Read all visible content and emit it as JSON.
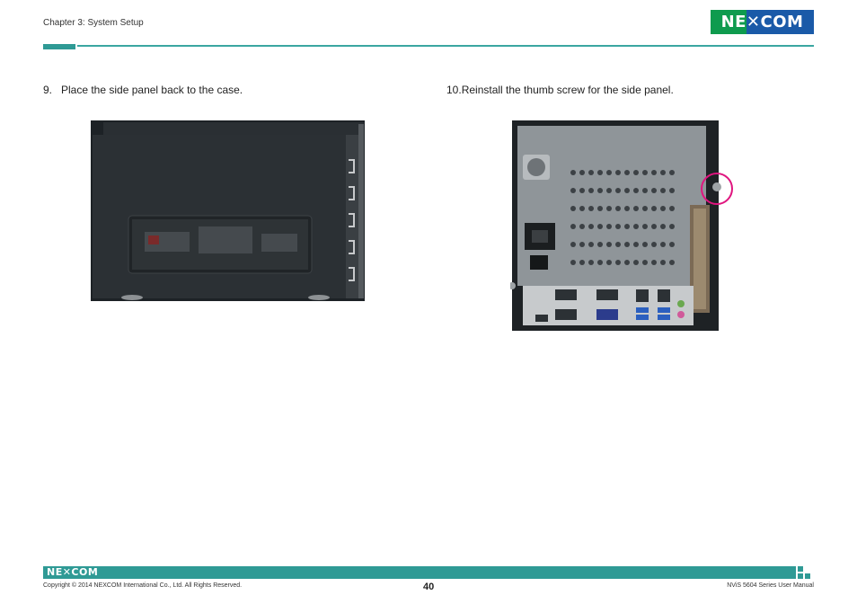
{
  "header": {
    "chapter": "Chapter 3: System Setup",
    "logo_text": "NE✕COM"
  },
  "steps": [
    {
      "number": "9.",
      "text": "Place the side panel back to the case."
    },
    {
      "number": "10.",
      "text": "Reinstall the thumb screw for the side panel."
    }
  ],
  "figures": {
    "left": "side-panel-installed-photo",
    "right": "rear-panel-thumb-screw-photo"
  },
  "footer": {
    "logo_text": "NE✕COM",
    "copyright": "Copyright © 2014 NEXCOM International Co., Ltd. All Rights Reserved.",
    "page": "40",
    "manual": "NViS 5604 Series User Manual"
  },
  "colors": {
    "accent": "#2f9a95",
    "logo_green": "#0e9b4e",
    "logo_blue": "#1a5aa8",
    "highlight_circle": "#e0157f"
  }
}
